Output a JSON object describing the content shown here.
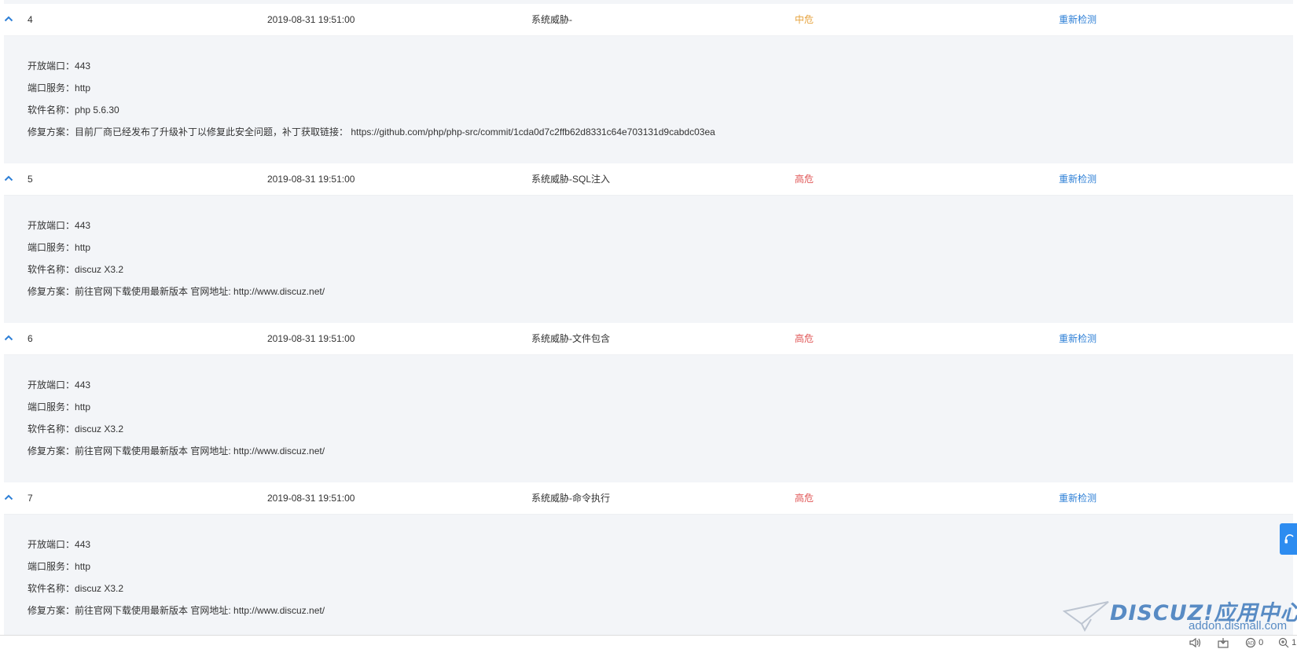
{
  "columns": {
    "action_label": "重新检测"
  },
  "detail_labels": {
    "port": "开放端口：",
    "service": "端口服务：",
    "software": "软件名称：",
    "fix": "修复方案："
  },
  "rows": [
    {
      "num": "4",
      "time": "2019-08-31 19:51:00",
      "type": "系统威胁-",
      "level": "中危",
      "level_color": "#e6a23c",
      "port": "443",
      "service": "http",
      "software": "php 5.6.30",
      "fix": "目前厂商已经发布了升级补丁以修复此安全问题，补丁获取链接： https://github.com/php/php-src/commit/1cda0d7c2ffb62d8331c64e703131d9cabdc03ea"
    },
    {
      "num": "5",
      "time": "2019-08-31 19:51:00",
      "type": "系统威胁-SQL注入",
      "level": "高危",
      "level_color": "#e05555",
      "port": "443",
      "service": "http",
      "software": "discuz X3.2",
      "fix": "前往官网下载使用最新版本 官网地址: http://www.discuz.net/"
    },
    {
      "num": "6",
      "time": "2019-08-31 19:51:00",
      "type": "系统威胁-文件包含",
      "level": "高危",
      "level_color": "#e05555",
      "port": "443",
      "service": "http",
      "software": "discuz X3.2",
      "fix": "前往官网下载使用最新版本 官网地址: http://www.discuz.net/"
    },
    {
      "num": "7",
      "time": "2019-08-31 19:51:00",
      "type": "系统威胁-命令执行",
      "level": "高危",
      "level_color": "#e05555",
      "port": "443",
      "service": "http",
      "software": "discuz X3.2",
      "fix": "前往官网下载使用最新版本 官网地址: http://www.discuz.net/"
    }
  ],
  "icons": {
    "row_toggle": "chevron-up-icon",
    "float": "customer-service-icon"
  },
  "watermark": {
    "logo": "DISCUZ!应用中心",
    "site": "addon.dismall.com"
  },
  "status_bar": {
    "ad_count": "0",
    "zoom": "1"
  }
}
